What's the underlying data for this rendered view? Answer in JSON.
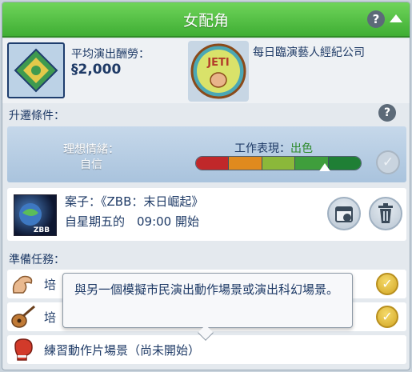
{
  "header": {
    "title": "女配角",
    "help_label": "?"
  },
  "info": {
    "pay_label": "平均演出酬勞：",
    "pay_value": "§2,000",
    "company_name": "每日臨演藝人經紀公司",
    "company_logo_text": "JETI"
  },
  "promotion": {
    "section_label": "升遷條件：",
    "help_label": "?",
    "mood_label": "理想情緒：",
    "mood_value": "自信",
    "performance_label": "工作表現：",
    "performance_value": "出色",
    "performance_segment_colors": [
      "#c0282a",
      "#e08a1e",
      "#8bb83a",
      "#3f9e3c",
      "#1f7f35"
    ],
    "performance_level": 0.78,
    "check_glyph": "✓"
  },
  "gig": {
    "title": "案子：《ZBB：末日崛起》",
    "time": "自星期五的　09:00 開始",
    "image_caption": "ZBB"
  },
  "tasks": {
    "section_label": "準備任務：",
    "items": [
      {
        "icon": "muscle-arm-icon",
        "text": "培",
        "complete": true
      },
      {
        "icon": "guitar-icon",
        "text": "培",
        "complete": true
      },
      {
        "icon": "boxing-glove-icon",
        "text": "練習動作片場景（尚未開始）",
        "complete": false
      }
    ],
    "check_glyph": "✓"
  },
  "tooltip": {
    "text": "與另一個模擬市民演出動作場景或演出科幻場景。"
  },
  "colors": {
    "header_green": "#4cbf3f",
    "accent_gold": "#e2b93c",
    "text_navy": "#1e3a66"
  }
}
